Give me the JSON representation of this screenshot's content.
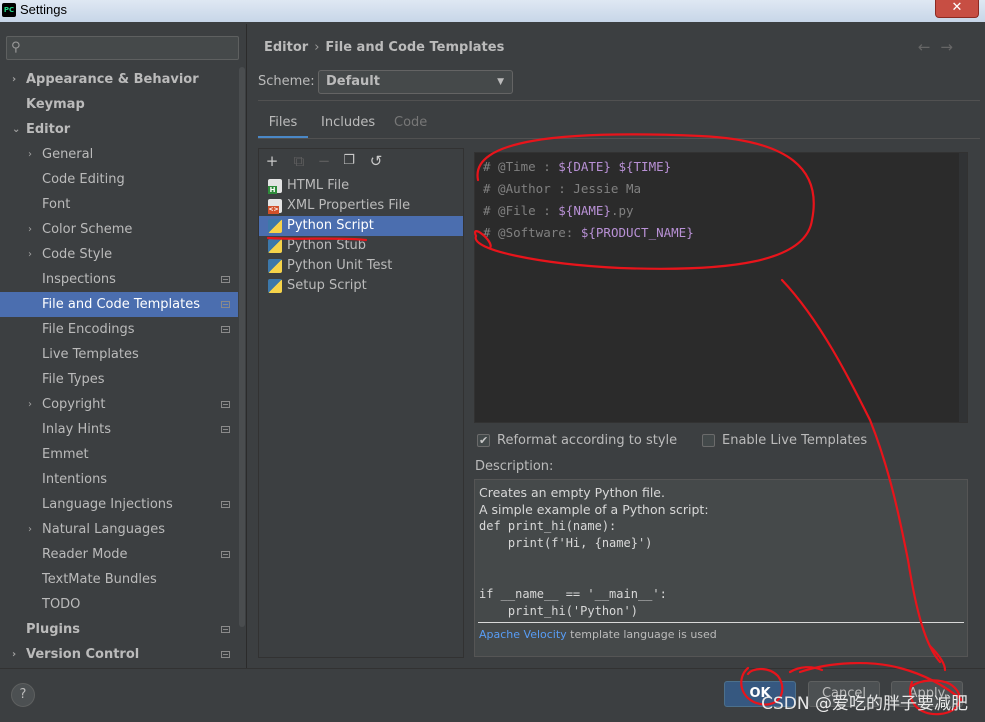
{
  "window": {
    "title": "Settings",
    "app_icon": "PC",
    "close_glyph": "✕"
  },
  "sidebar": {
    "search_placeholder": "",
    "items": [
      {
        "label": "Appearance & Behavior",
        "level": 0,
        "bold": true,
        "arrow": "›",
        "pm": false,
        "selected": false
      },
      {
        "label": "Keymap",
        "level": 0,
        "bold": true,
        "arrow": "",
        "pm": false,
        "selected": false
      },
      {
        "label": "Editor",
        "level": 0,
        "bold": true,
        "arrow": "⌄",
        "pm": false,
        "selected": false
      },
      {
        "label": "General",
        "level": 1,
        "bold": false,
        "arrow": "›",
        "pm": false,
        "selected": false
      },
      {
        "label": "Code Editing",
        "level": 1,
        "bold": false,
        "arrow": "",
        "pm": false,
        "selected": false
      },
      {
        "label": "Font",
        "level": 1,
        "bold": false,
        "arrow": "",
        "pm": false,
        "selected": false
      },
      {
        "label": "Color Scheme",
        "level": 1,
        "bold": false,
        "arrow": "›",
        "pm": false,
        "selected": false
      },
      {
        "label": "Code Style",
        "level": 1,
        "bold": false,
        "arrow": "›",
        "pm": false,
        "selected": false
      },
      {
        "label": "Inspections",
        "level": 1,
        "bold": false,
        "arrow": "",
        "pm": true,
        "selected": false
      },
      {
        "label": "File and Code Templates",
        "level": 1,
        "bold": false,
        "arrow": "",
        "pm": true,
        "selected": true
      },
      {
        "label": "File Encodings",
        "level": 1,
        "bold": false,
        "arrow": "",
        "pm": true,
        "selected": false
      },
      {
        "label": "Live Templates",
        "level": 1,
        "bold": false,
        "arrow": "",
        "pm": false,
        "selected": false
      },
      {
        "label": "File Types",
        "level": 1,
        "bold": false,
        "arrow": "",
        "pm": false,
        "selected": false
      },
      {
        "label": "Copyright",
        "level": 1,
        "bold": false,
        "arrow": "›",
        "pm": true,
        "selected": false
      },
      {
        "label": "Inlay Hints",
        "level": 1,
        "bold": false,
        "arrow": "",
        "pm": true,
        "selected": false
      },
      {
        "label": "Emmet",
        "level": 1,
        "bold": false,
        "arrow": "",
        "pm": false,
        "selected": false
      },
      {
        "label": "Intentions",
        "level": 1,
        "bold": false,
        "arrow": "",
        "pm": false,
        "selected": false
      },
      {
        "label": "Language Injections",
        "level": 1,
        "bold": false,
        "arrow": "",
        "pm": true,
        "selected": false
      },
      {
        "label": "Natural Languages",
        "level": 1,
        "bold": false,
        "arrow": "›",
        "pm": false,
        "selected": false
      },
      {
        "label": "Reader Mode",
        "level": 1,
        "bold": false,
        "arrow": "",
        "pm": true,
        "selected": false
      },
      {
        "label": "TextMate Bundles",
        "level": 1,
        "bold": false,
        "arrow": "",
        "pm": false,
        "selected": false
      },
      {
        "label": "TODO",
        "level": 1,
        "bold": false,
        "arrow": "",
        "pm": false,
        "selected": false
      },
      {
        "label": "Plugins",
        "level": 0,
        "bold": true,
        "arrow": "",
        "pm": true,
        "selected": false
      },
      {
        "label": "Version Control",
        "level": 0,
        "bold": true,
        "arrow": "›",
        "pm": true,
        "selected": false
      }
    ]
  },
  "header": {
    "crumb_parent": "Editor",
    "crumb_sep": "›",
    "crumb_current": "File and Code Templates",
    "nav_back": "←",
    "nav_forward": "→"
  },
  "scheme": {
    "label": "Scheme:",
    "value": "Default",
    "arrow": "▼"
  },
  "tabs": [
    {
      "label": "Files",
      "active": true,
      "disabled": false
    },
    {
      "label": "Includes",
      "active": false,
      "disabled": false
    },
    {
      "label": "Code",
      "active": false,
      "disabled": true
    }
  ],
  "toolbar": {
    "add": "+",
    "copy": "⧉",
    "remove": "−",
    "duplicate": "❐",
    "reset": "↺"
  },
  "files": [
    {
      "label": "HTML File",
      "icon": "html-file-icon",
      "selected": false
    },
    {
      "label": "XML Properties File",
      "icon": "xml-file-icon",
      "selected": false
    },
    {
      "label": "Python Script",
      "icon": "python-icon",
      "selected": true
    },
    {
      "label": "Python Stub",
      "icon": "python-icon",
      "selected": false
    },
    {
      "label": "Python Unit Test",
      "icon": "python-icon",
      "selected": false
    },
    {
      "label": "Setup Script",
      "icon": "python-icon",
      "selected": false
    }
  ],
  "editor": {
    "lines": [
      {
        "comment": "# @Time : ",
        "vars": "${DATE} ${TIME}"
      },
      {
        "comment": "# @Author : Jessie Ma",
        "vars": ""
      },
      {
        "comment": "# @File : ",
        "vars": "${NAME}",
        "suffix": ".py"
      },
      {
        "comment": "# @Software: ",
        "vars": "${PRODUCT_NAME}"
      }
    ]
  },
  "options": {
    "reformat_label": "Reformat according to style",
    "reformat_checked": true,
    "live_templates_label": "Enable Live Templates",
    "live_templates_checked": false
  },
  "description": {
    "label": "Description:",
    "text": "Creates an empty Python file.\nA simple example of a Python script:",
    "code": "def print_hi(name):\n    print(f'Hi, {name}')\n\n\nif __name__ == '__main__':\n    print_hi('Python')",
    "footer_link": "Apache Velocity",
    "footer_text": " template language is used"
  },
  "buttons": {
    "help": "?",
    "ok": "OK",
    "cancel": "Cancel",
    "apply": "Apply"
  },
  "watermark": "CSDN @爱吃的胖子要减肥",
  "colors": {
    "accent": "#4b6eaf",
    "annotation": "#e8141b",
    "template_var": "#b991d6"
  }
}
